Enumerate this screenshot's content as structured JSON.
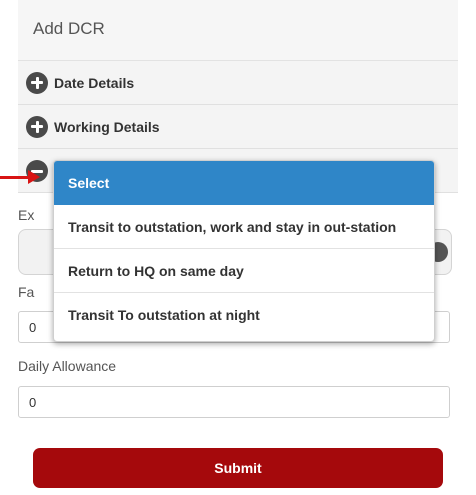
{
  "header": {
    "title": "Add DCR"
  },
  "sections": [
    {
      "label": "Date Details",
      "icon": "plus-circle-icon"
    },
    {
      "label": "Working Details",
      "icon": "plus-circle-icon"
    }
  ],
  "expenses": {
    "expense_type_label_partial": "Ex",
    "fare_label_partial": "Fa",
    "fare_value_partial": "0",
    "daily_allowance_label": "Daily Allowance",
    "daily_allowance_value": "0"
  },
  "dropdown": {
    "options": [
      {
        "label": "Select",
        "selected": true
      },
      {
        "label": "Transit to outstation, work and stay in out-station",
        "selected": false
      },
      {
        "label": "Return to HQ on same day",
        "selected": false
      },
      {
        "label": "Transit To outstation at night",
        "selected": false
      }
    ],
    "highlight_color": "#2f86c8"
  },
  "submit": {
    "label": "Submit",
    "color": "#a5090c"
  },
  "annotation": {
    "icon": "red-arrow-icon",
    "color": "#d81414"
  }
}
